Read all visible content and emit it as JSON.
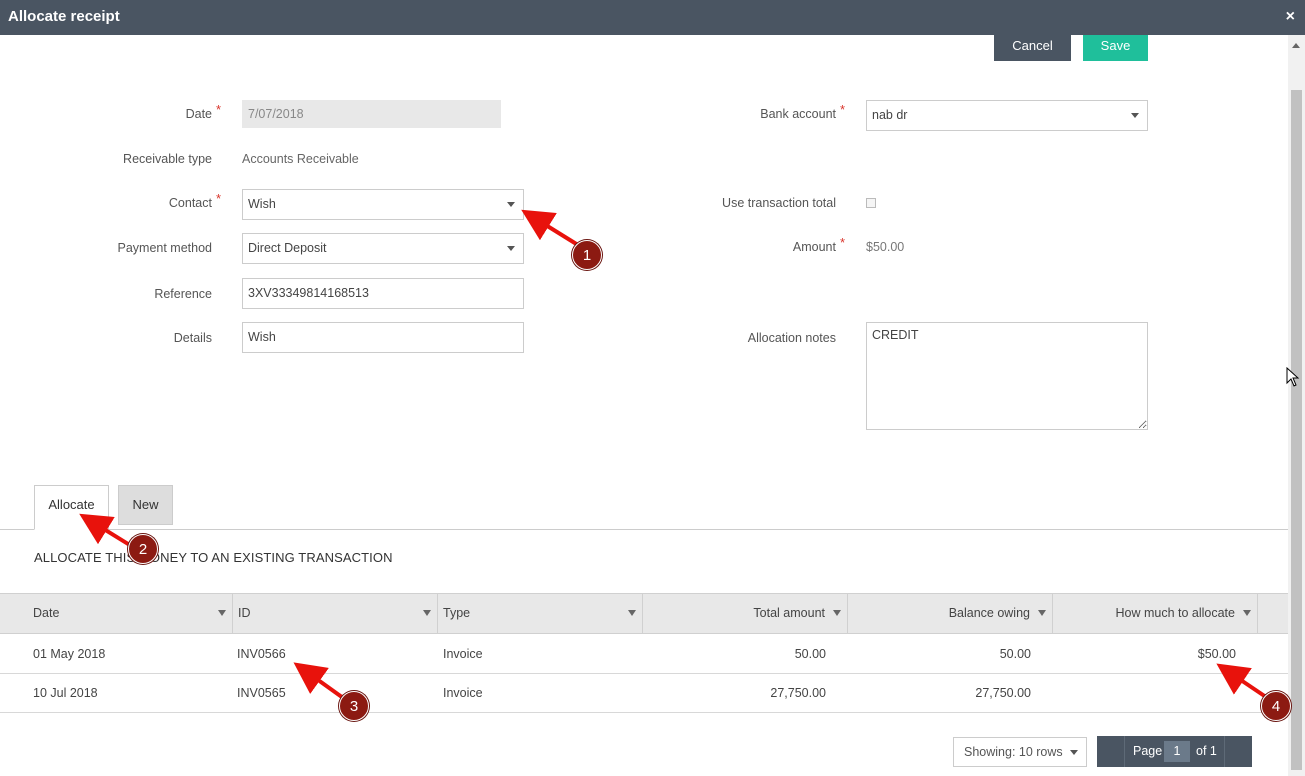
{
  "window": {
    "title": "Allocate receipt",
    "close": "×"
  },
  "toolbar": {
    "cancel_label": "Cancel",
    "save_label": "Save"
  },
  "form": {
    "date_label": "Date",
    "date_value": "7/07/2018",
    "receivable_type_label": "Receivable type",
    "receivable_type_value": "Accounts Receivable",
    "contact_label": "Contact",
    "contact_value": "Wish",
    "payment_method_label": "Payment method",
    "payment_method_value": "Direct Deposit",
    "reference_label": "Reference",
    "reference_value": "3XV33349814168513",
    "details_label": "Details",
    "details_value": "Wish",
    "bank_account_label": "Bank account",
    "bank_account_value": "nab dr",
    "use_total_label": "Use transaction total",
    "use_total_checked": false,
    "amount_label": "Amount",
    "amount_value": "$50.00",
    "notes_label": "Allocation notes",
    "notes_value": "CREDIT",
    "required_mark": "*"
  },
  "tabs": [
    {
      "label": "Allocate",
      "active": true
    },
    {
      "label": "New",
      "active": false
    }
  ],
  "section_title": "ALLOCATE THIS MONEY TO AN EXISTING TRANSACTION",
  "table": {
    "columns": [
      "Date",
      "ID",
      "Type",
      "Total amount",
      "Balance owing",
      "How much to allocate"
    ],
    "rows": [
      {
        "date": "01 May 2018",
        "id": "INV0566",
        "type": "Invoice",
        "total": "50.00",
        "balance": "50.00",
        "allocate": "$50.00"
      },
      {
        "date": "10 Jul 2018",
        "id": "INV0565",
        "type": "Invoice",
        "total": "27,750.00",
        "balance": "27,750.00",
        "allocate": ""
      }
    ]
  },
  "pager": {
    "showing": "Showing: 10 rows",
    "page_label": "Page",
    "page_num": "1",
    "of_label": "of 1"
  },
  "annotations": {
    "badges": [
      "1",
      "2",
      "3",
      "4"
    ],
    "color": "#e8120c"
  }
}
